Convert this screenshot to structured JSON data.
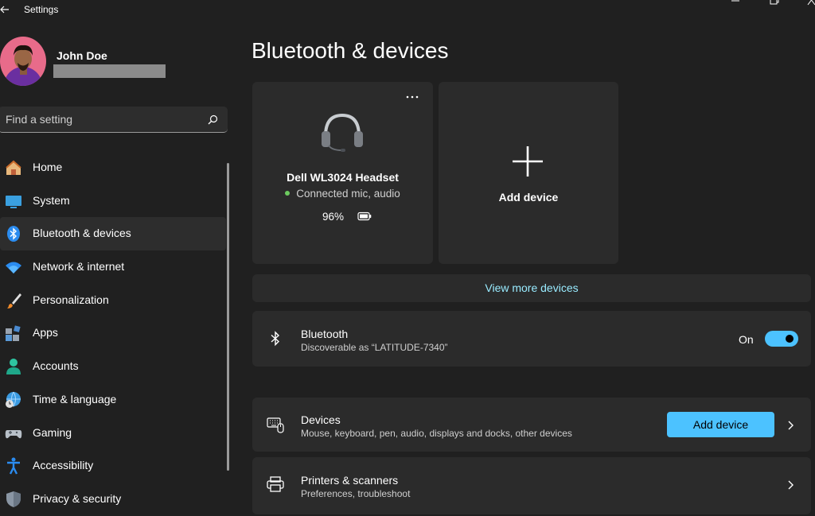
{
  "app": {
    "title": "Settings"
  },
  "profile": {
    "name": "John Doe"
  },
  "search": {
    "placeholder": "Find a setting"
  },
  "nav": {
    "items": [
      {
        "label": "Home",
        "icon": "home-icon"
      },
      {
        "label": "System",
        "icon": "system-icon"
      },
      {
        "label": "Bluetooth & devices",
        "icon": "bluetooth-icon",
        "active": true
      },
      {
        "label": "Network & internet",
        "icon": "wifi-icon"
      },
      {
        "label": "Personalization",
        "icon": "brush-icon"
      },
      {
        "label": "Apps",
        "icon": "apps-icon"
      },
      {
        "label": "Accounts",
        "icon": "accounts-icon"
      },
      {
        "label": "Time & language",
        "icon": "globe-clock-icon"
      },
      {
        "label": "Gaming",
        "icon": "gamepad-icon"
      },
      {
        "label": "Accessibility",
        "icon": "accessibility-icon"
      },
      {
        "label": "Privacy & security",
        "icon": "shield-icon"
      }
    ]
  },
  "main": {
    "title": "Bluetooth & devices",
    "device_card": {
      "name": "Dell WL3024 Headset",
      "status": "Connected mic, audio",
      "battery": "96%"
    },
    "add_card": {
      "label": "Add device"
    },
    "view_more": "View more devices",
    "bluetooth": {
      "title": "Bluetooth",
      "subtitle": "Discoverable as “LATITUDE-7340”",
      "state_label": "On",
      "on": true
    },
    "devices_row": {
      "title": "Devices",
      "subtitle": "Mouse, keyboard, pen, audio, displays and docks, other devices",
      "button": "Add device"
    },
    "printers_row": {
      "title": "Printers & scanners",
      "subtitle": "Preferences, troubleshoot"
    }
  },
  "colors": {
    "background": "#202020",
    "card": "#2b2b2b",
    "accent": "#4cc2ff",
    "link": "#99ebff",
    "connected": "#6ccb5f"
  }
}
